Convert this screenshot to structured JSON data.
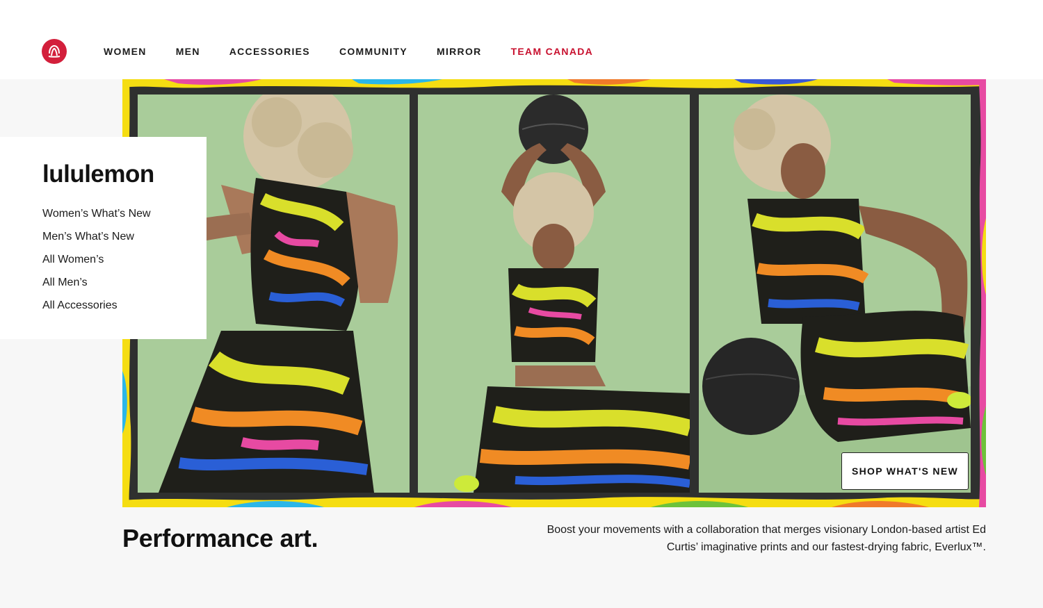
{
  "header": {
    "logo_icon": "lululemon-logo-icon",
    "brand_color": "#d31f3b",
    "nav": [
      {
        "label": "WOMEN"
      },
      {
        "label": "MEN"
      },
      {
        "label": "ACCESSORIES"
      },
      {
        "label": "COMMUNITY"
      },
      {
        "label": "MIRROR"
      },
      {
        "label": "TEAM CANADA",
        "color": "#c8102e"
      }
    ]
  },
  "side_card": {
    "title": "lululemon",
    "links": [
      {
        "label": "Women’s What’s New"
      },
      {
        "label": "Men’s What’s New"
      },
      {
        "label": "All Women’s"
      },
      {
        "label": "All Men’s"
      },
      {
        "label": "All Accessories"
      }
    ]
  },
  "hero": {
    "cta_label": "SHOP WHAT'S NEW",
    "panel_background": "#a9cc9a"
  },
  "content": {
    "headline": "Performance art.",
    "description": "Boost your movements with a collaboration that merges visionary London-based artist Ed Curtis’ imaginative prints and our fastest-drying fabric, Everlux™."
  }
}
